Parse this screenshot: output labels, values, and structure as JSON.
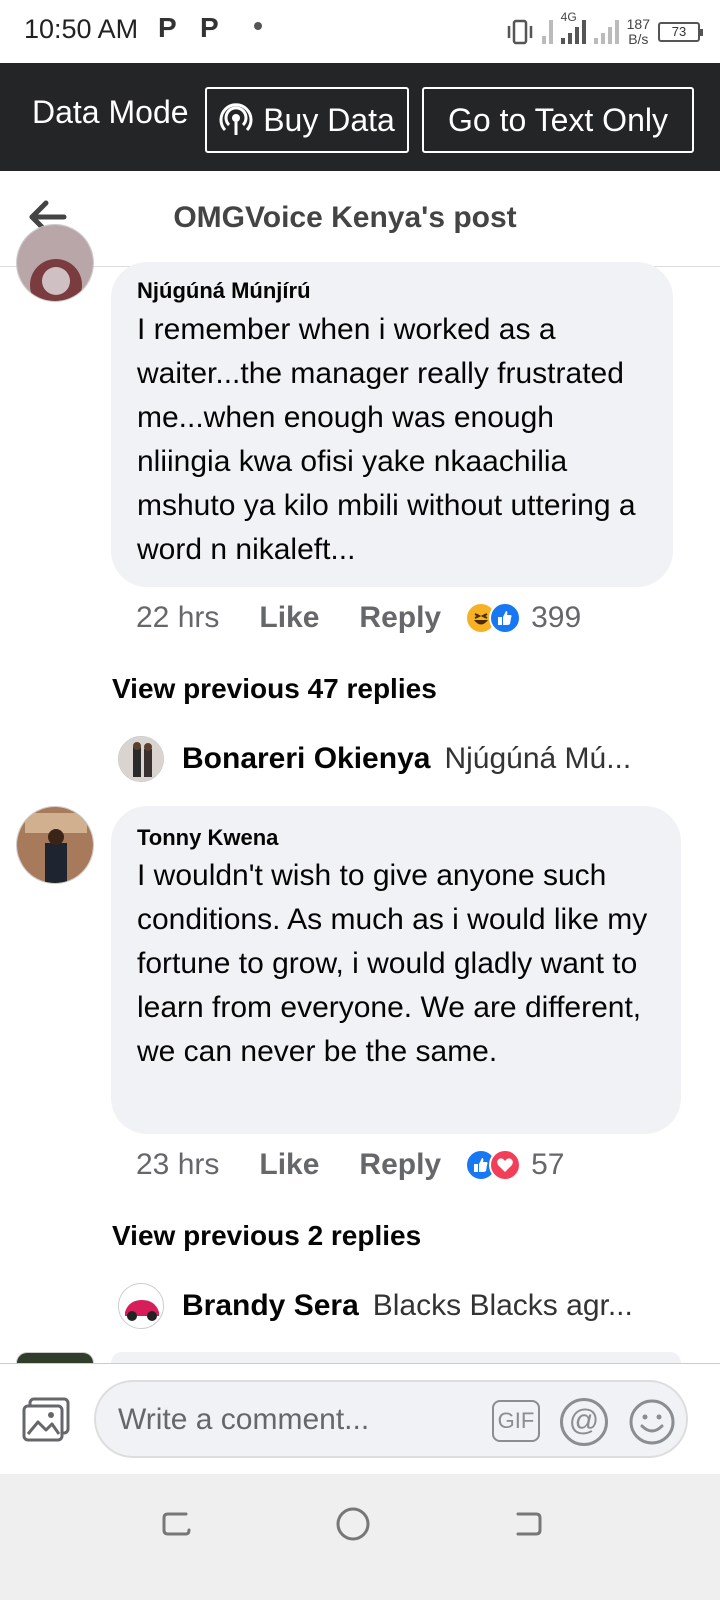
{
  "status_bar": {
    "time": "10:50 AM",
    "notif_icons": [
      "P",
      "P"
    ],
    "network": "4G",
    "speed_value": "187",
    "speed_unit": "B/s",
    "battery": "73"
  },
  "data_mode": {
    "label": "Data Mode",
    "buy_data_label": "Buy Data",
    "text_only_label": "Go to Text Only"
  },
  "header": {
    "title": "OMGVoice Kenya's post"
  },
  "comments": [
    {
      "author": "Njúgúná Múnjírú",
      "text": "I remember when i worked  as a waiter...the manager really frustrated me...when enough  was enough nliingia kwa ofisi yake nkaachilia mshuto ya kilo mbili without uttering a word n nikaleft...",
      "time": "22 hrs",
      "like_label": "Like",
      "reply_label": "Reply",
      "reactions": [
        "haha",
        "like"
      ],
      "reaction_count": "399",
      "view_previous": "View previous 47 replies",
      "latest_reply": {
        "name": "Bonareri Okienya",
        "snippet": "Njúgúná Mú..."
      }
    },
    {
      "author": "Tonny Kwena",
      "text": "I wouldn't wish to give anyone such conditions. As much as i would like my fortune to grow, i would gladly want to learn from everyone. We are different, we can never be the same.",
      "time": "23 hrs",
      "like_label": "Like",
      "reply_label": "Reply",
      "reactions": [
        "like",
        "love"
      ],
      "reaction_count": "57",
      "view_previous": "View previous 2 replies",
      "latest_reply": {
        "name": "Brandy Sera",
        "snippet": "Blacks Blacks agr..."
      }
    }
  ],
  "composer": {
    "placeholder": "Write a comment...",
    "gif_label": "GIF",
    "at_label": "@"
  },
  "colors": {
    "data_bar": "#242526",
    "bubble": "#f0f2f5",
    "like_blue": "#1877f2",
    "love_red": "#f33e58",
    "haha_yellow": "#f7b125",
    "secondary_text": "#65676b"
  }
}
